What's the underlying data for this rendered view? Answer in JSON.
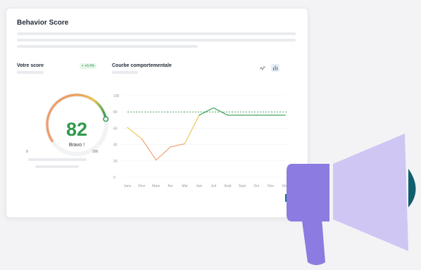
{
  "card": {
    "title": "Behavior Score"
  },
  "score_panel": {
    "label": "Votre score",
    "badge": "+ +0,4%",
    "value": "82",
    "caption": "Bravo !",
    "min_label": "0",
    "max_label": "100",
    "fraction": 0.82
  },
  "chart_panel": {
    "label": "Courbe comportementale",
    "icons": [
      "line-chart-icon",
      "bar-chart-icon"
    ]
  },
  "chart_data": {
    "type": "line",
    "categories": [
      "Janv",
      "Févr",
      "Mars",
      "Avr",
      "Mai",
      "Juin",
      "Juil",
      "Août",
      "Sept",
      "Oct",
      "Nov",
      "Déc"
    ],
    "series": [
      {
        "values": [
          61,
          47,
          21,
          37,
          41,
          76,
          85,
          76,
          76,
          76,
          76,
          76
        ]
      }
    ],
    "reference_line": 80,
    "ylim": [
      0,
      100
    ],
    "yticks": [
      "0",
      "20",
      "40",
      "60",
      "80",
      "100"
    ],
    "grid": true,
    "colors": {
      "low": "#f09a6a",
      "mid": "#e9c54a",
      "high": "#2e9a4c",
      "reference": "#2e9a4c"
    }
  },
  "colors": {
    "accent_green": "#2e9a4c",
    "megaphone_body": "#8c7be0",
    "megaphone_cone": "#cfc6f4",
    "teal": "#115e6e",
    "bar_blue": "#1a6f91"
  }
}
